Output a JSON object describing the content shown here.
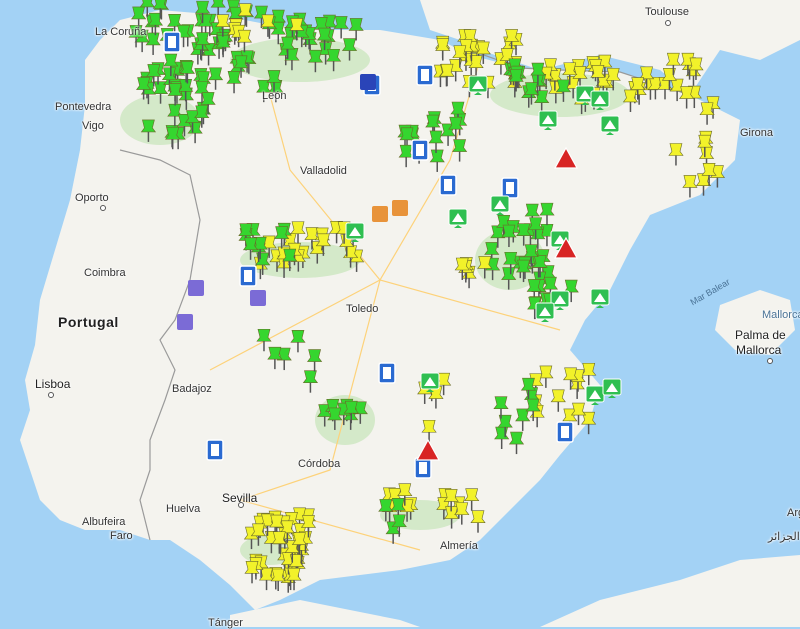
{
  "map": {
    "labels": {
      "toulouse": "Toulouse",
      "lacoruna": "La Coruña",
      "pontevedra": "Pontevedra",
      "vigo": "Vigo",
      "oporto": "Oporto",
      "leon": "León",
      "valladolid": "Valladolid",
      "coimbra": "Coimbra",
      "portugal": "Portugal",
      "toledo": "Toledo",
      "lisboa": "Lisboa",
      "badajoz": "Badajoz",
      "cordoba": "Córdoba",
      "sevilla": "Sevilla",
      "huelva": "Huelva",
      "albufeira": "Albufeira",
      "faro": "Faro",
      "almeria": "Almería",
      "tanger": "Tánger",
      "girona": "Girona",
      "marbalear": "Mar Balear",
      "mallorca": "Mallorca",
      "palma": "Palma de",
      "palma2": "Mallorca",
      "argel": "الجزائر",
      "arg": "Arg"
    },
    "colors": {
      "water": "#a3d2f5",
      "land": "#f4f3ee",
      "park": "#d4e9c9",
      "border": "#9a9a9a",
      "green_pin": "#35d62f",
      "yellow_pin": "#f2f22a",
      "road_sign": "#2a6ad1",
      "warning": "#d82424",
      "camp": "#2fbf51"
    },
    "markers": {
      "green_pin": "green-pushpin",
      "yellow_pin": "yellow-pushpin",
      "road_sign": "road-sign-icon",
      "tent": "tent-icon",
      "warning": "warning-icon",
      "castle": "castle-icon",
      "house": "house-icon",
      "book": "book-icon"
    }
  }
}
